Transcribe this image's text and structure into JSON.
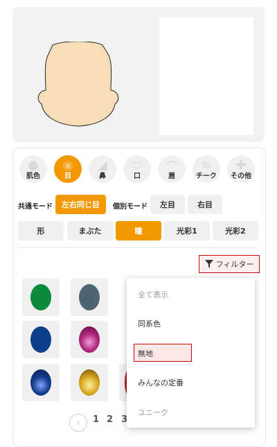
{
  "categories": [
    {
      "label": "肌色",
      "icon": "skin-icon"
    },
    {
      "label": "目",
      "icon": "eye-icon",
      "active": true
    },
    {
      "label": "鼻",
      "icon": "nose-icon"
    },
    {
      "label": "口",
      "icon": "mouth-icon"
    },
    {
      "label": "眉",
      "icon": "eyebrow-icon"
    },
    {
      "label": "チーク",
      "icon": "cheek-icon"
    },
    {
      "label": "その他",
      "icon": "other-icon"
    }
  ],
  "modes": {
    "common_label": "共通モード",
    "common_btn": "左右同じ目",
    "individual_label": "個別モード",
    "left_btn": "左目",
    "right_btn": "右目"
  },
  "tabs": [
    "形",
    "まぶた",
    "瞳",
    "光彩1",
    "光彩2"
  ],
  "filter_label": "フィルター",
  "swatch_colors": [
    "#0a8a3c",
    "#4e6470",
    "#0e3f8a",
    "#b0267e",
    "#123c8c",
    "#b08a12",
    "#b02020"
  ],
  "pagination": {
    "pages": [
      "1",
      "2",
      "3"
    ]
  },
  "dropdown": {
    "items": [
      "全て表示",
      "同系色",
      "無地",
      "みんなの定番",
      "ユニーク"
    ],
    "selected_index": 2
  },
  "colors": {
    "accent": "#f39800",
    "highlight": "#cc0000"
  }
}
